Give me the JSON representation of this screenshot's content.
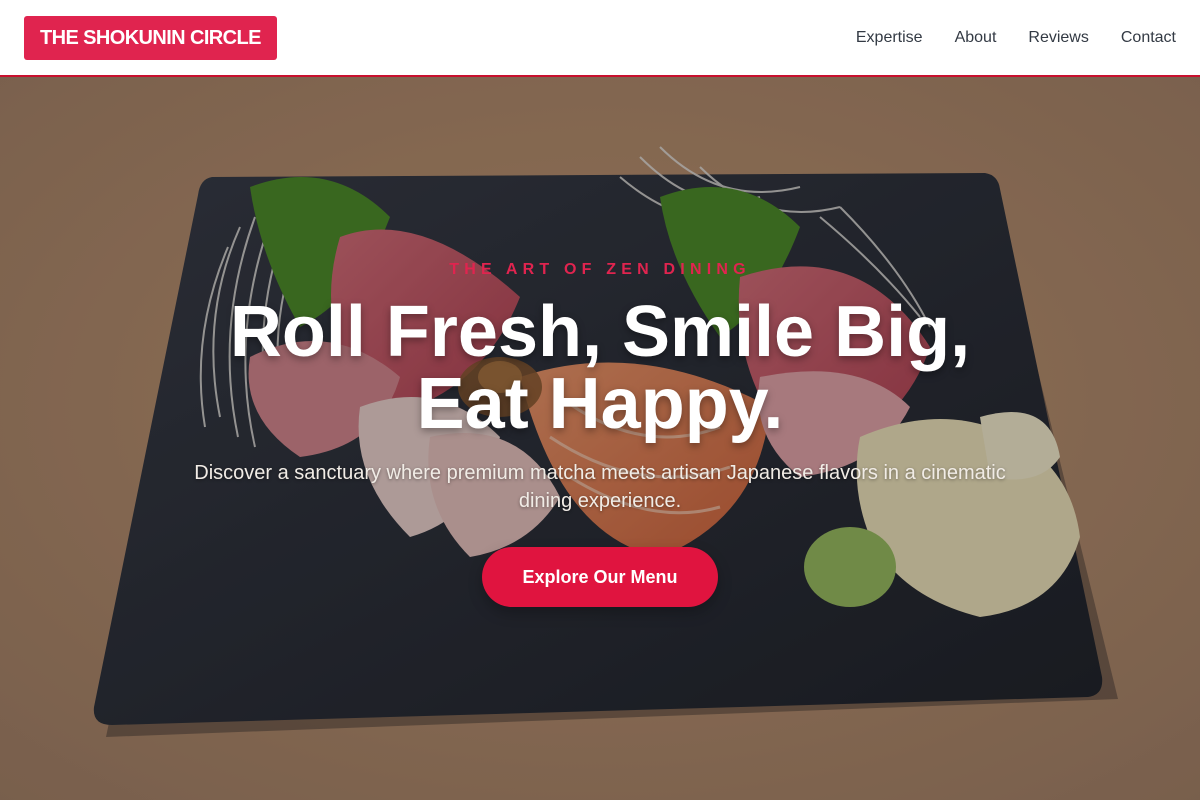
{
  "header": {
    "logo_text": "THE SHOKUNIN CIRCLE",
    "nav": [
      {
        "label": "Expertise"
      },
      {
        "label": "About"
      },
      {
        "label": "Reviews"
      },
      {
        "label": "Contact"
      }
    ]
  },
  "hero": {
    "eyebrow": "THE ART OF ZEN DINING",
    "title_line1": "Roll Fresh, Smile Big,",
    "title_line2": "Eat Happy.",
    "subtitle": "Discover a sanctuary where premium matcha meets artisan Japanese flavors in a cinematic dining experience.",
    "cta_label": "Explore Our Menu",
    "background_image": "sashimi-platter-on-slate-board"
  },
  "colors": {
    "accent": "#e0244f",
    "cta": "#e0143f",
    "header_border": "#c8102e",
    "nav_text": "#333a44"
  }
}
